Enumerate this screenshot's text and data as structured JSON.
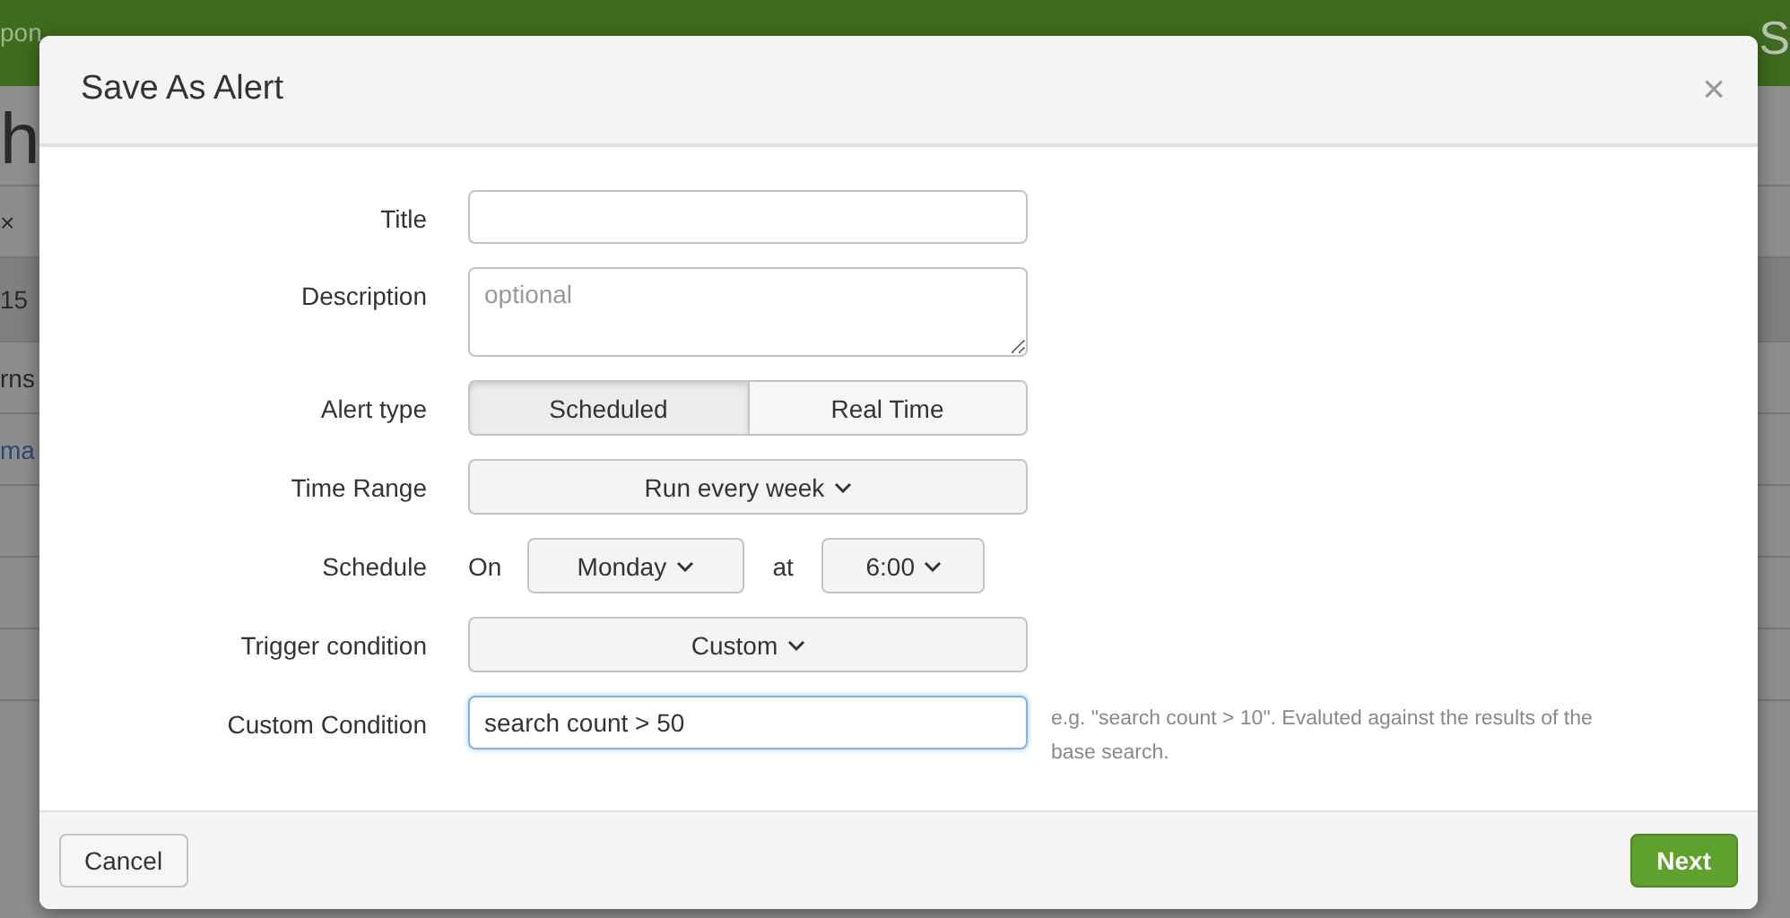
{
  "background": {
    "app_bar_left": "pon",
    "app_bar_right": "S",
    "heading": "h",
    "rows": [
      {
        "texts": [
          "×"
        ],
        "kind": "plain"
      },
      {
        "texts": [
          "15"
        ],
        "kind": "shaded"
      },
      {
        "texts": [
          "rns"
        ],
        "kind": "plain"
      },
      {
        "texts": [
          "ma"
        ],
        "kind": "link"
      },
      {
        "texts": [],
        "kind": "plain"
      },
      {
        "texts": [],
        "kind": "plain"
      },
      {
        "texts": [],
        "kind": "plain"
      }
    ]
  },
  "dialog": {
    "title": "Save As Alert",
    "close": "×",
    "fields": [
      {
        "label": "Title",
        "kind": "text"
      },
      {
        "label": "Description",
        "kind": "textarea",
        "placeholder": "optional"
      },
      {
        "label": "Alert type",
        "kind": "toggle",
        "options": [
          {
            "label": "Scheduled",
            "selected": true
          },
          {
            "label": "Real Time",
            "selected": false
          }
        ]
      },
      {
        "label": "Time Range",
        "kind": "dropdown",
        "value": "Run every week"
      },
      {
        "label": "Schedule",
        "kind": "schedule",
        "on": "On",
        "day": "Monday",
        "at": "at",
        "time": "6:00"
      },
      {
        "label": "Trigger condition",
        "kind": "dropdown",
        "value": "Custom"
      },
      {
        "label": "Custom Condition",
        "kind": "condition",
        "value": "search count > 50",
        "focused": true,
        "help": "e.g. \"search count > 10\". Evaluted against the results of the base search."
      }
    ],
    "buttons": {
      "cancel": "Cancel",
      "next": "Next"
    }
  }
}
